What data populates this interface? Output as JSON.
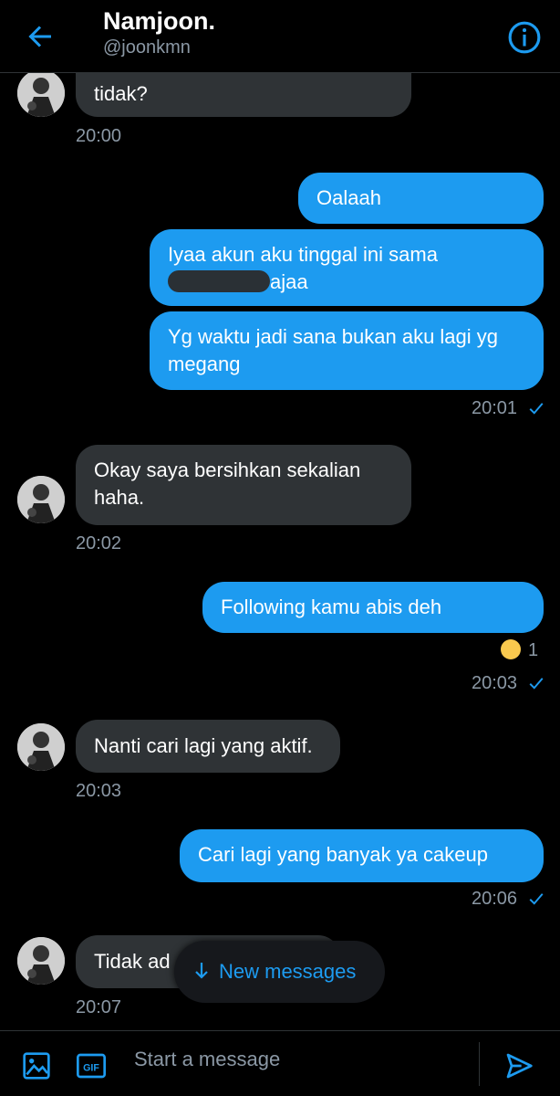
{
  "header": {
    "name": "Namjoon.",
    "handle": "@joonkmn"
  },
  "messages": [
    {
      "text": "tidak?",
      "time": "20:00"
    },
    {
      "text": "Oalaah"
    },
    {
      "line1": "Iyaa akun aku tinggal ini sama",
      "line2_end": "ajaa"
    },
    {
      "text": "Yg waktu jadi sana bukan aku lagi yg megang",
      "time": "20:01"
    },
    {
      "text": "Okay saya bersihkan sekalian haha.",
      "time": "20:02"
    },
    {
      "text": "Following kamu abis deh",
      "time": "20:03",
      "reaction_count": "1"
    },
    {
      "text": "Nanti cari lagi yang aktif.",
      "time": "20:03"
    },
    {
      "text": "Cari lagi yang banyak ya cakeup",
      "time": "20:06"
    },
    {
      "text": "Tidak ad",
      "time": "20:07"
    }
  ],
  "new_messages": {
    "label": "New messages"
  },
  "composer": {
    "placeholder": "Start a message",
    "gif_label": "GIF"
  },
  "colors": {
    "accent": "#1d9bf0",
    "incoming_bubble": "#2f3336",
    "muted": "#8b98a5"
  }
}
